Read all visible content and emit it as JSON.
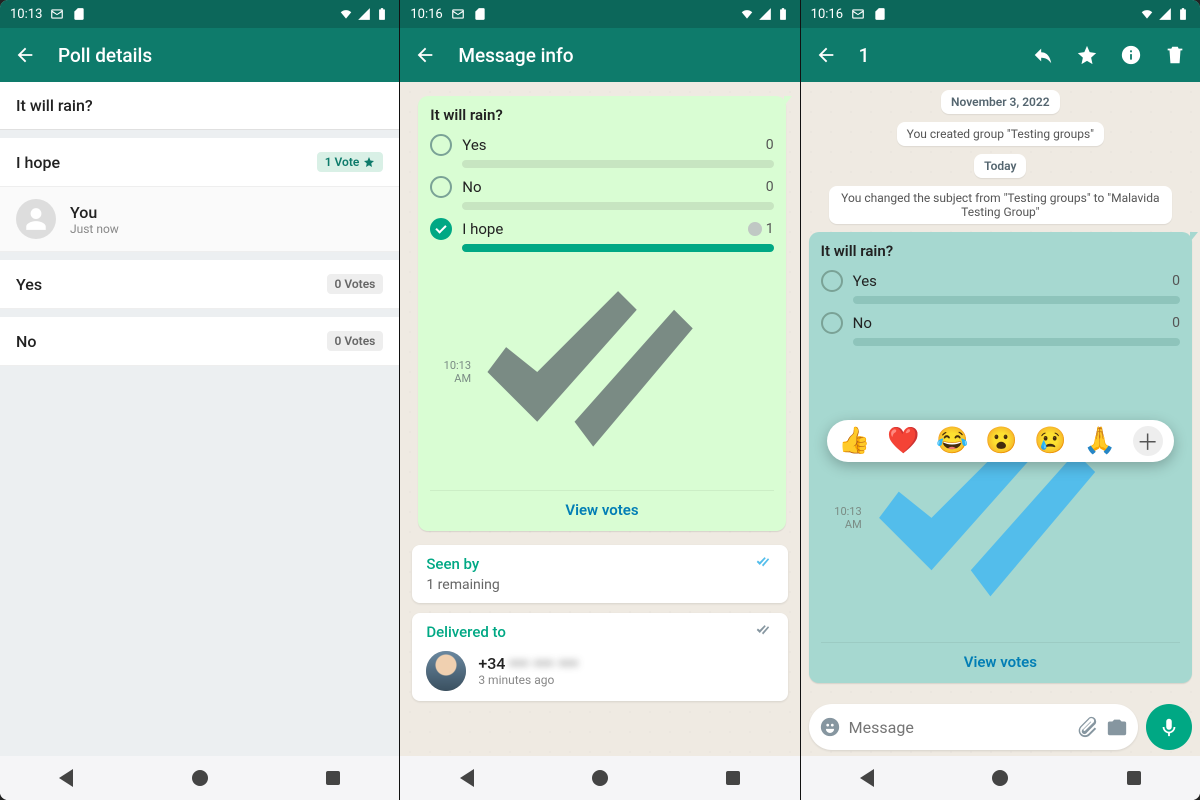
{
  "colors": {
    "primary": "#0e7b6b",
    "accent": "#00a884",
    "link": "#027eb5"
  },
  "screen1": {
    "status_time": "10:13",
    "title": "Poll details",
    "question": "It will rain?",
    "options": [
      {
        "label": "I hope",
        "votes_text": "1 Vote",
        "highlight": true,
        "voters": [
          {
            "name": "You",
            "time": "Just now"
          }
        ]
      },
      {
        "label": "Yes",
        "votes_text": "0 Votes",
        "highlight": false,
        "voters": []
      },
      {
        "label": "No",
        "votes_text": "0 Votes",
        "highlight": false,
        "voters": []
      }
    ]
  },
  "screen2": {
    "status_time": "10:16",
    "title": "Message info",
    "poll": {
      "question": "It will rain?",
      "options": [
        {
          "label": "Yes",
          "count": 0,
          "checked": false,
          "fill_pct": 0
        },
        {
          "label": "No",
          "count": 0,
          "checked": false,
          "fill_pct": 0
        },
        {
          "label": "I hope",
          "count": 1,
          "checked": true,
          "fill_pct": 100,
          "avatar": true
        }
      ],
      "time": "10:13 AM",
      "view_votes": "View votes"
    },
    "seen_by": {
      "title": "Seen by",
      "remaining": "1 remaining"
    },
    "delivered": {
      "title": "Delivered to",
      "contact_prefix": "+34",
      "contact_rest": "••• ••• •••",
      "contact_time": "3 minutes ago"
    }
  },
  "screen3": {
    "status_time": "10:16",
    "selection_count": "1",
    "date_chip": "November 3, 2022",
    "sys1": "You created group \"Testing groups\"",
    "today_chip": "Today",
    "sys2": "You changed the subject from \"Testing groups\" to \"Malavida Testing Group\"",
    "poll": {
      "question": "It will rain?",
      "options": [
        {
          "label": "Yes",
          "count": 0,
          "checked": false,
          "fill_pct": 0
        },
        {
          "label": "No",
          "count": 0,
          "checked": false,
          "fill_pct": 0
        }
      ],
      "time": "10:13 AM",
      "view_votes": "View votes"
    },
    "reactions": [
      "👍",
      "❤️",
      "😂",
      "😮",
      "😢",
      "🙏"
    ],
    "input_placeholder": "Message"
  }
}
